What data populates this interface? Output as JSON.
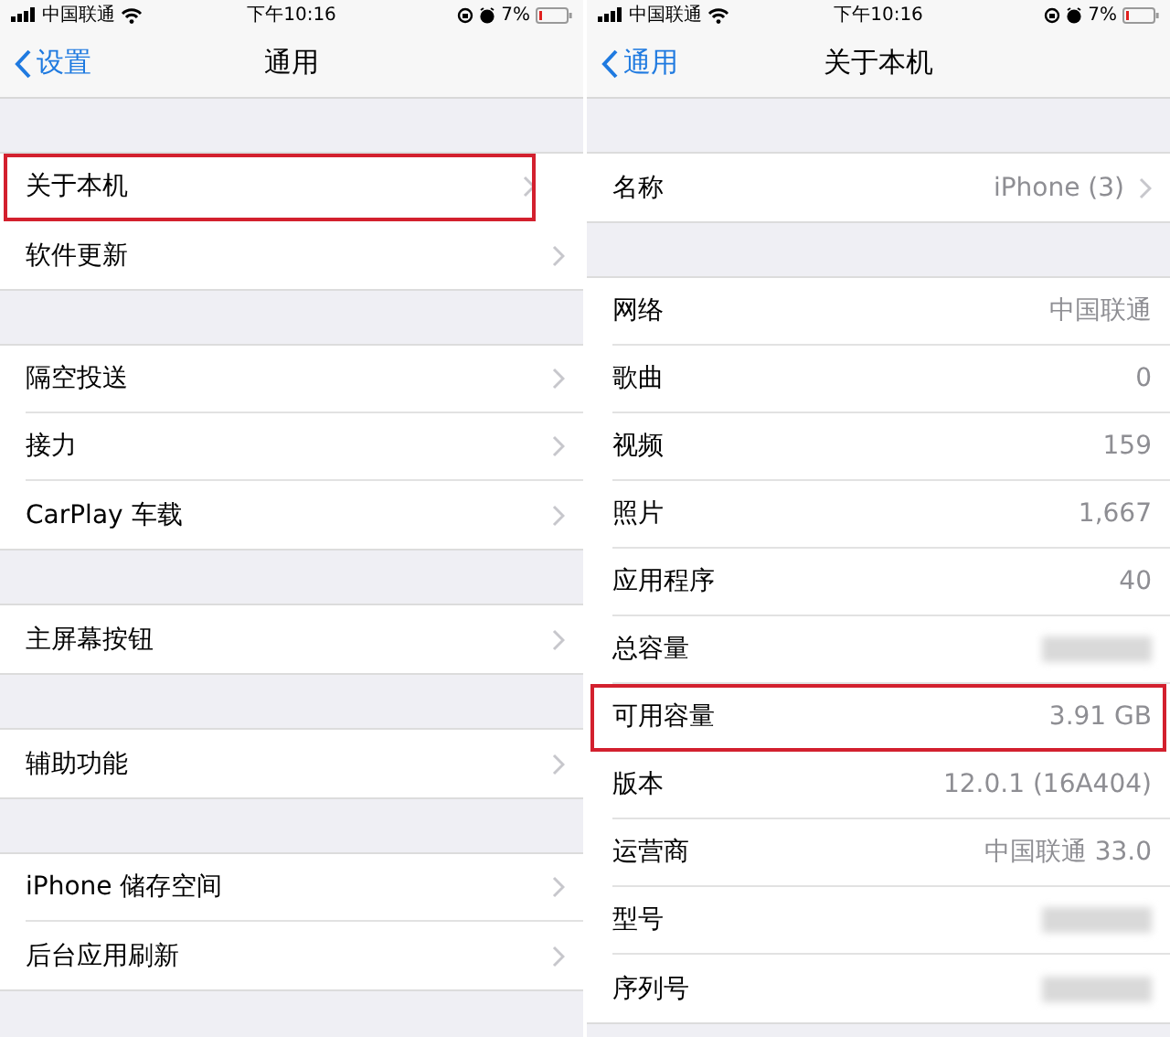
{
  "screens": [
    {
      "status": {
        "carrier": "中国联通",
        "time": "下午10:16",
        "battery": "7%"
      },
      "nav": {
        "back": "设置",
        "title": "通用"
      },
      "groups": [
        [
          {
            "label": "关于本机",
            "chevron": true,
            "highlighted": true
          },
          {
            "label": "软件更新",
            "chevron": true,
            "highlighted": false
          }
        ],
        [
          {
            "label": "隔空投送",
            "chevron": true,
            "highlighted": false
          },
          {
            "label": "接力",
            "chevron": true,
            "highlighted": false
          },
          {
            "label": "CarPlay 车载",
            "chevron": true,
            "highlighted": false
          }
        ],
        [
          {
            "label": "主屏幕按钮",
            "chevron": true,
            "highlighted": false
          }
        ],
        [
          {
            "label": "辅助功能",
            "chevron": true,
            "highlighted": false
          }
        ],
        [
          {
            "label": "iPhone 储存空间",
            "chevron": true,
            "highlighted": false
          },
          {
            "label": "后台应用刷新",
            "chevron": true,
            "highlighted": false
          }
        ]
      ]
    },
    {
      "status": {
        "carrier": "中国联通",
        "time": "下午10:16",
        "battery": "7%"
      },
      "nav": {
        "back": "通用",
        "title": "关于本机"
      },
      "groups": [
        [
          {
            "label": "名称",
            "value": "iPhone (3)",
            "chevron": true,
            "highlighted": false
          }
        ],
        [
          {
            "label": "网络",
            "value": "中国联通",
            "chevron": false,
            "highlighted": false
          },
          {
            "label": "歌曲",
            "value": "0",
            "chevron": false,
            "highlighted": false
          },
          {
            "label": "视频",
            "value": "159",
            "chevron": false,
            "highlighted": false
          },
          {
            "label": "照片",
            "value": "1,667",
            "chevron": false,
            "highlighted": false
          },
          {
            "label": "应用程序",
            "value": "40",
            "chevron": false,
            "highlighted": false
          },
          {
            "label": "总容量",
            "redacted": true,
            "chevron": false,
            "highlighted": false
          },
          {
            "label": "可用容量",
            "value": "3.91 GB",
            "chevron": false,
            "highlighted": true
          },
          {
            "label": "版本",
            "value": "12.0.1 (16A404)",
            "chevron": false,
            "highlighted": false
          },
          {
            "label": "运营商",
            "value": "中国联通 33.0",
            "chevron": false,
            "highlighted": false
          },
          {
            "label": "型号",
            "redacted": true,
            "chevron": false,
            "highlighted": false
          },
          {
            "label": "序列号",
            "redacted": true,
            "chevron": false,
            "highlighted": false
          }
        ]
      ]
    }
  ]
}
